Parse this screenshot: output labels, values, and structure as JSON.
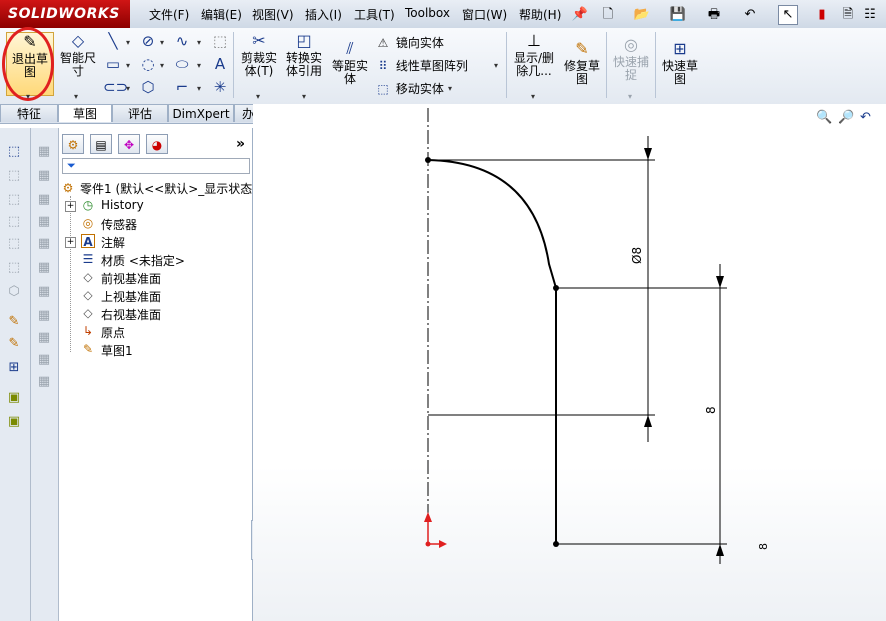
{
  "app": {
    "logo": "SOLIDWORKS"
  },
  "menubar": [
    "文件(F)",
    "编辑(E)",
    "视图(V)",
    "插入(I)",
    "工具(T)",
    "Toolbox",
    "窗口(W)",
    "帮助(H)"
  ],
  "ribbon": {
    "exit_sketch": "退出草\n图",
    "smart_dim": "智能尺\n寸",
    "trim": "剪裁实\n体(T)",
    "convert": "转换实\n体引用",
    "offset": "等距实\n体",
    "mirror": "镜向实体",
    "linear_pattern": "线性草图阵列",
    "move": "移动实体",
    "show_delete": "显示/删\n除几...",
    "repair": "修复草\n图",
    "quick_snap": "快速捕\n捉",
    "rapid_sketch": "快速草\n图"
  },
  "tabs": [
    "特征",
    "草图",
    "评估",
    "DimXpert",
    "办公室产品"
  ],
  "active_tab": "草图",
  "feature_tree": {
    "root": "零件1 (默认<<默认>_显示状态",
    "items": [
      {
        "label": "History",
        "icon": "history-icon"
      },
      {
        "label": "传感器",
        "icon": "sensor-icon"
      },
      {
        "label": "注解",
        "icon": "annotation-icon"
      },
      {
        "label": "材质 <未指定>",
        "icon": "material-icon"
      },
      {
        "label": "前视基准面",
        "icon": "plane-icon"
      },
      {
        "label": "上视基准面",
        "icon": "plane-icon"
      },
      {
        "label": "右视基准面",
        "icon": "plane-icon"
      },
      {
        "label": "原点",
        "icon": "origin-icon"
      },
      {
        "label": "草图1",
        "icon": "sketch-icon"
      }
    ]
  },
  "dimensions": {
    "dia_label": "Ø8",
    "height_label": "8",
    "partial_label": "8"
  },
  "colors": {
    "highlight_circle": "#e02020",
    "brand": "#c00000"
  }
}
